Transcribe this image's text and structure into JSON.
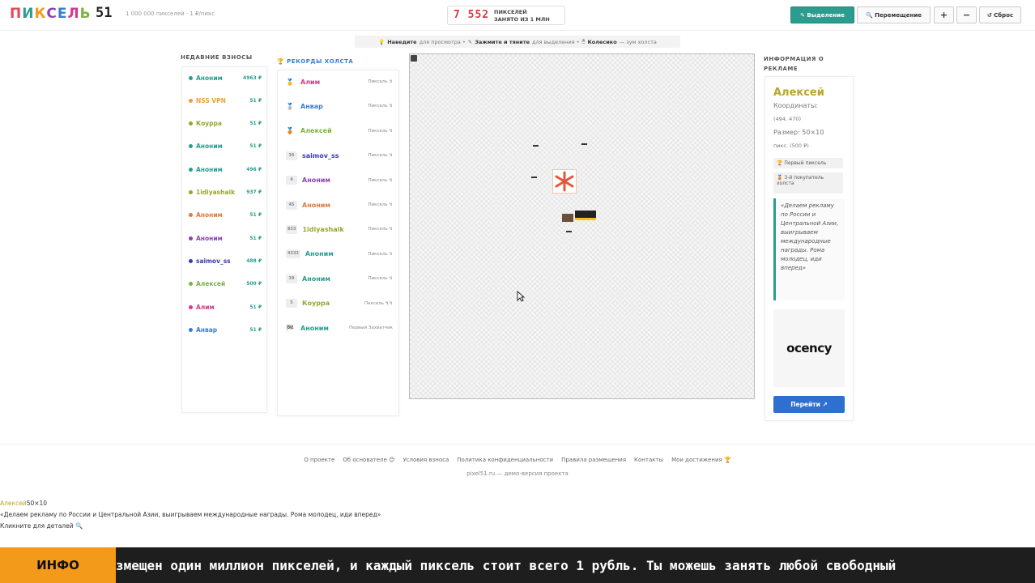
{
  "header": {
    "logo_letters": [
      "П",
      "И",
      "К",
      "С",
      "Е",
      "Л",
      "Ь"
    ],
    "logo_colors": [
      "#e84855",
      "#2a9d8f",
      "#f39a1b",
      "#8e44ad",
      "#3a7bd5",
      "#d63a8a",
      "#7cb342"
    ],
    "logo_num": "51",
    "tagline": "1 000 000 пикселей · 1 ₽/пикс",
    "counter_value": "7 552",
    "counter_line1": "ПИКСЕЛЕЙ",
    "counter_line2": "ЗАНЯТО ИЗ 1 МЛН",
    "btn_select": "✎ Выделение",
    "btn_move": "🔍 Перемещение",
    "btn_zoom_in": "+",
    "btn_zoom_out": "−",
    "btn_reset": "↺ Сброс"
  },
  "hint": {
    "part1_icon": "💡",
    "part1_bold": "Наведите",
    "part1_rest": "для просмотра •",
    "part2_icon": "✎",
    "part2_bold": "Зажмите и тяните",
    "part2_rest": "для выделения •",
    "part3_icon": "🖱",
    "part3_bold": "Колесико",
    "part3_rest": "— зум холста"
  },
  "recent": {
    "title": "НЕДАВНИЕ ВЗНОСЫ",
    "items": [
      {
        "name": "Аноним",
        "amount": "4963 ₽",
        "color": "#2a9d8f"
      },
      {
        "name": "NSS VPN",
        "amount": "51 ₽",
        "color": "#e6a23c"
      },
      {
        "name": "Коурра",
        "amount": "51 ₽",
        "color": "#9aa52a"
      },
      {
        "name": "Аноним",
        "amount": "51 ₽",
        "color": "#2a9d8f"
      },
      {
        "name": "Аноним",
        "amount": "496 ₽",
        "color": "#2a9d8f"
      },
      {
        "name": "1idiyashaik",
        "amount": "937 ₽",
        "color": "#9aa52a"
      },
      {
        "name": "Аноним",
        "amount": "51 ₽",
        "color": "#e07a3c"
      },
      {
        "name": "Аноним",
        "amount": "51 ₽",
        "color": "#8e44ad"
      },
      {
        "name": "saimov_ss",
        "amount": "488 ₽",
        "color": "#3a3ab0"
      },
      {
        "name": "Алексей",
        "amount": "500 ₽",
        "color": "#7cb342"
      },
      {
        "name": "Алим",
        "amount": "51 ₽",
        "color": "#d63a8a"
      },
      {
        "name": "Анвар",
        "amount": "51 ₽",
        "color": "#3a7bd5"
      }
    ]
  },
  "records": {
    "title": "🏆 РЕКОРДЫ ХОЛСТА",
    "items": [
      {
        "medal": "🥇",
        "badge": "",
        "name": "Алим",
        "sub": "Пиксель ↯",
        "color": "#d63a8a"
      },
      {
        "medal": "🥈",
        "badge": "",
        "name": "Анвар",
        "sub": "Пиксель ↯",
        "color": "#3a7bd5"
      },
      {
        "medal": "🥉",
        "badge": "",
        "name": "Алексей",
        "sub": "Пиксель ↯",
        "color": "#7cb342"
      },
      {
        "medal": "",
        "badge": "36",
        "name": "saimov_ss",
        "sub": "Пиксель ↯",
        "color": "#3a3ab0"
      },
      {
        "medal": "",
        "badge": "4",
        "name": "Аноним",
        "sub": "Пиксель ↯",
        "color": "#8e44ad"
      },
      {
        "medal": "",
        "badge": "45",
        "name": "Аноним",
        "sub": "Пиксель ↯",
        "color": "#e07a3c"
      },
      {
        "medal": "",
        "badge": "833",
        "name": "1idiyashaik",
        "sub": "Пиксель ↯",
        "color": "#9aa52a"
      },
      {
        "medal": "",
        "badge": "4333",
        "name": "Аноним",
        "sub": "Пиксель ↯",
        "color": "#2a9d8f"
      },
      {
        "medal": "",
        "badge": "39",
        "name": "Аноним",
        "sub": "Пиксель ↯",
        "color": "#2a9d8f"
      },
      {
        "medal": "",
        "badge": "5",
        "name": "Коурра",
        "sub": "Пиксель ↯↯",
        "color": "#9aa52a"
      },
      {
        "medal": "🏁",
        "badge": "",
        "name": "Аноним",
        "sub": "Первый Захватчик",
        "color": "#2a9d8f"
      }
    ]
  },
  "ad": {
    "title": "ИНФОРМАЦИЯ О РЕКЛАМЕ",
    "name": "Алексей",
    "coords_label": "Координаты:",
    "coords_value": "(494, 470)",
    "size_label": "Размер: 50×10",
    "size_value": "пикс. (500 ₽)",
    "chip1": "🏆 Первый пиксель",
    "chip2": "🥉 3-й покупатель холста",
    "quote": "«Делаем рекламу по России и Центральной Азии, выигрываем международные награды. Рома молодец, иди вперед»",
    "logo_text": "ocency",
    "button": "Перейти ↗"
  },
  "footer": {
    "links": [
      "О проекте",
      "Об основателе 😊",
      "Условия взноса",
      "Политика конфиденциальности",
      "Правила размещения",
      "Контакты",
      "Мои достижения 🏆"
    ],
    "copy": "pixel51.ru — демо-версия проекта"
  },
  "tooltip": {
    "name": "Алексей",
    "size": "50×10",
    "quote": "«Делаем рекламу по России и Центральной Азии, выигрываем международные награды. Рома молодец, иди вперед»",
    "hint": "Кликните для деталей 🔍"
  },
  "ticker": {
    "label": "ИНФО",
    "text": "змещен один миллион пикселей, и каждый пиксель стоит всего 1 рубль. Ты можешь занять любой свободный"
  }
}
